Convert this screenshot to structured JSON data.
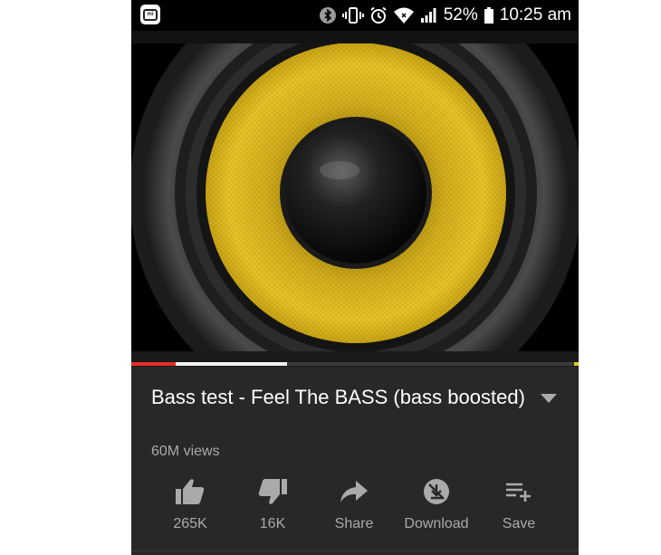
{
  "status_bar": {
    "battery_percent": "52%",
    "time": "10:25 am",
    "icons": [
      "mi-app-icon",
      "bluetooth-icon",
      "vibrate-icon",
      "alarm-icon",
      "wifi-icon",
      "signal-icon",
      "battery-icon"
    ]
  },
  "video": {
    "thumbnail": "yellow-speaker-woofer",
    "progress_played": 0.1,
    "progress_buffered": 0.35
  },
  "info": {
    "title": "Bass test - Feel The BASS (bass boosted)",
    "views": "60M views"
  },
  "actions": [
    {
      "label": "265K",
      "icon": "thumbs-up-icon"
    },
    {
      "label": "16K",
      "icon": "thumbs-down-icon"
    },
    {
      "label": "Share",
      "icon": "share-icon"
    },
    {
      "label": "Download",
      "icon": "download-disabled-icon"
    },
    {
      "label": "Save",
      "icon": "playlist-add-icon"
    }
  ],
  "colors": {
    "background": "#282828",
    "text_primary": "#ffffff",
    "text_secondary": "#aaaaaa",
    "progress_played": "#e52d27",
    "speaker_cone": "#e0b820"
  }
}
